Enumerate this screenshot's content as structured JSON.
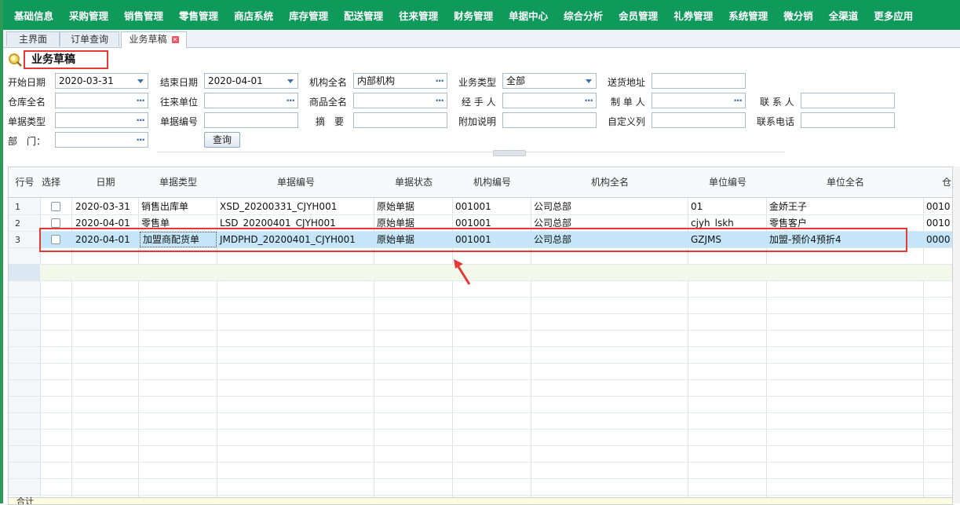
{
  "nav": {
    "items": [
      "基础信息",
      "采购管理",
      "销售管理",
      "零售管理",
      "商店系统",
      "库存管理",
      "配送管理",
      "往来管理",
      "财务管理",
      "单据中心",
      "综合分析",
      "会员管理",
      "礼券管理",
      "系统管理",
      "微分销",
      "全渠道",
      "更多应用"
    ]
  },
  "tabs": {
    "home": "主界面",
    "order_query": "订单查询",
    "draft": "业务草稿"
  },
  "page": {
    "title": "业务草稿"
  },
  "filters": {
    "start_date_label": "开始日期",
    "start_date_value": "2020-03-31",
    "end_date_label": "结束日期",
    "end_date_value": "2020-04-01",
    "org_name_label": "机构全名",
    "org_name_value": "内部机构",
    "biz_type_label": "业务类型",
    "biz_type_value": "全部",
    "ship_addr_label": "送货地址",
    "warehouse_label": "仓库全名",
    "partner_label": "往来单位",
    "product_label": "商品全名",
    "handler_label": "经 手 人",
    "maker_label": "制 单 人",
    "contact_label": "联 系 人",
    "doc_type_label": "单据类型",
    "doc_no_label": "单据编号",
    "summary_label": "摘　要",
    "extra_label": "附加说明",
    "custom_col_label": "自定义列",
    "phone_label": "联系电话",
    "dept_label": "部　门：",
    "query_button": "查询"
  },
  "grid": {
    "columns": [
      "行号",
      "选择",
      "日期",
      "单据类型",
      "单据编号",
      "单据状态",
      "机构编号",
      "机构全名",
      "单位编号",
      "单位全名",
      "仓"
    ],
    "rows": [
      {
        "no": "1",
        "date": "2020-03-31",
        "type": "销售出库单",
        "doc_no": "XSD_20200331_CJYH001",
        "status": "原始单据",
        "org_no": "001001",
        "org_name": "公司总部",
        "unit_no": "01",
        "unit_name": "金娇王子",
        "wh": "0010"
      },
      {
        "no": "2",
        "date": "2020-04-01",
        "type": "零售单",
        "doc_no": "LSD_20200401_CJYH001",
        "status": "原始单据",
        "org_no": "001001",
        "org_name": "公司总部",
        "unit_no": "cjyh_lskh",
        "unit_name": "零售客户",
        "wh": "0010"
      },
      {
        "no": "3",
        "date": "2020-04-01",
        "type": "加盟商配货单",
        "doc_no": "JMDPHD_20200401_CJYH001",
        "status": "原始单据",
        "org_no": "001001",
        "org_name": "公司总部",
        "unit_no": "GZJMS",
        "unit_name": "加盟-预价4预折4",
        "wh": "0000"
      }
    ],
    "footer_label": "合计"
  },
  "colors": {
    "nav_bg": "#0f9a5c",
    "selected_row": "#c4e6f8",
    "annotation_red": "#e53935"
  }
}
